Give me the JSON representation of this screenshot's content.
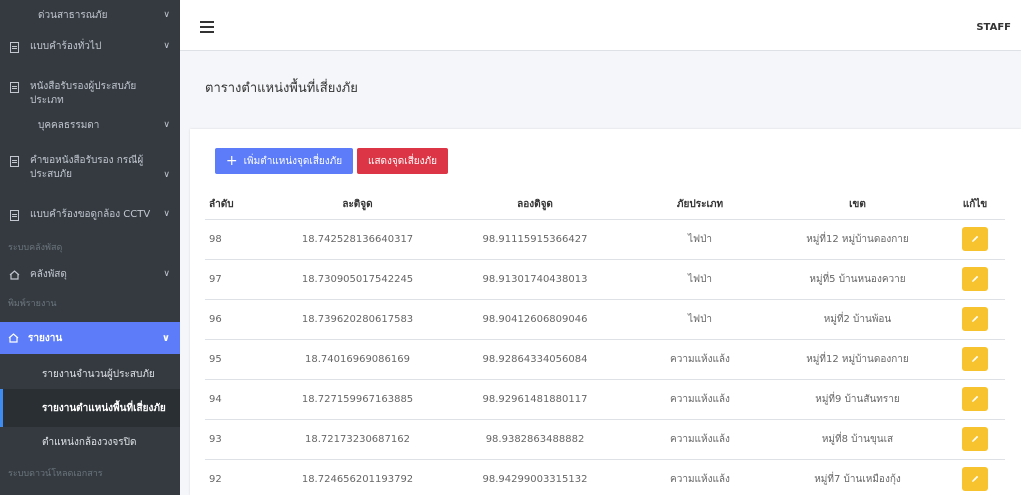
{
  "sidebar": {
    "items_top": [
      {
        "label": "ด่วนสาธารณภัย",
        "has_chevron": true
      },
      {
        "label": "แบบคำร้องทั่วไป",
        "has_chevron": true
      },
      {
        "label": "หนังสือรับรองผู้ประสบภัย ประเภท",
        "has_chevron": false
      },
      {
        "label": "บุคคลธรรมดา",
        "has_chevron": true
      },
      {
        "label": "คำขอหนังสือรับรอง กรณีผู้ประสบภัย",
        "has_chevron": true
      },
      {
        "label": "แบบคำร้องขอดูกล้อง CCTV",
        "has_chevron": true
      }
    ],
    "header_storage": "ระบบคลังพัสดุ",
    "storage_item": "คลังพัสดุ",
    "header_print": "พิมพ์รายงาน",
    "active_item": "รายงาน",
    "sub_items": [
      "รายงานจำนวนผู้ประสบภัย",
      "รายงานตำแหน่งพื้นที่เสี่ยงภัย",
      "ตำแหน่งกล้องวงจรปิด"
    ],
    "header_download": "ระบบดาวน์โหลดเอกสาร"
  },
  "navbar": {
    "user": "STAFF"
  },
  "page": {
    "title": "ตารางตำแหน่งพื้นที่เสี่ยงภัย"
  },
  "buttons": {
    "add": "เพิ่มตำแหน่งจุดเสี่ยงภัย",
    "show": "แสดงจุดเสี่ยงภัย"
  },
  "table": {
    "headers": [
      "ลำดับ",
      "ละติจูด",
      "ลองติจูด",
      "ภัยประเภท",
      "เขต",
      "แก้ไข"
    ],
    "rows": [
      {
        "no": "98",
        "lat": "18.742528136640317",
        "lng": "98.91115915366427",
        "type": "ไฟป่า",
        "zone": "หมู่ที่12 หมู่บ้านดองกาย"
      },
      {
        "no": "97",
        "lat": "18.730905017542245",
        "lng": "98.91301740438013",
        "type": "ไฟป่า",
        "zone": "หมู่ที่5 บ้านหนองควาย"
      },
      {
        "no": "96",
        "lat": "18.739620280617583",
        "lng": "98.90412606809046",
        "type": "ไฟป่า",
        "zone": "หมู่ที่2 บ้านพ้อน"
      },
      {
        "no": "95",
        "lat": "18.74016969086169",
        "lng": "98.92864334056084",
        "type": "ความแห้งแล้ง",
        "zone": "หมู่ที่12 หมู่บ้านดองกาย"
      },
      {
        "no": "94",
        "lat": "18.727159967163885",
        "lng": "98.92961481880117",
        "type": "ความแห้งแล้ง",
        "zone": "หมู่ที่9 บ้านสันทราย"
      },
      {
        "no": "93",
        "lat": "18.72173230687162",
        "lng": "98.9382863488882",
        "type": "ความแห้งแล้ง",
        "zone": "หมู่ที่8 บ้านขุนเส"
      },
      {
        "no": "92",
        "lat": "18.724656201193792",
        "lng": "98.94299003315132",
        "type": "ความแห้งแล้ง",
        "zone": "หมู่ที่7 บ้านเหมืองกุ้ง"
      }
    ]
  },
  "colors": {
    "sidebar_bg": "#343a40",
    "accent": "#5c7cfa",
    "danger": "#dc3545",
    "edit": "#f7c32e"
  }
}
